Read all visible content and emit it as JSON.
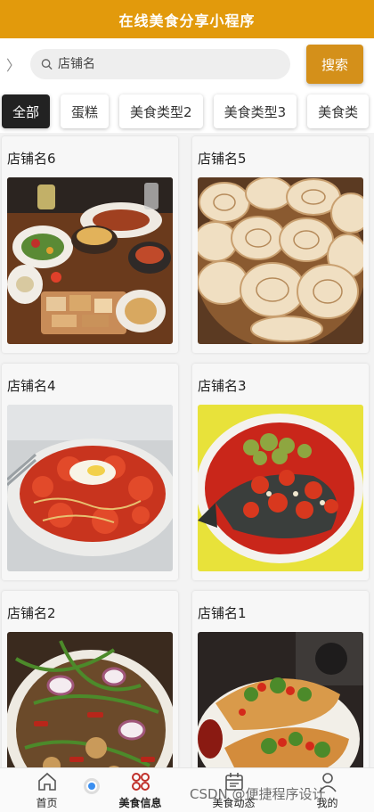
{
  "header": {
    "title": "在线美食分享小程序"
  },
  "search": {
    "placeholder": "店铺名",
    "button_label": "搜索"
  },
  "categories": [
    "全部",
    "蛋糕",
    "美食类型2",
    "美食类型3",
    "美食类"
  ],
  "shops": [
    {
      "name": "店铺名6",
      "image": "food-platter-photo"
    },
    {
      "name": "店铺名5",
      "image": "rose-pastry-photo"
    },
    {
      "name": "店铺名4",
      "image": "tomato-egg-pasta-photo"
    },
    {
      "name": "店铺名3",
      "image": "chili-fish-head-photo"
    },
    {
      "name": "店铺名2",
      "image": "stir-fry-salad-photo"
    },
    {
      "name": "店铺名1",
      "image": "stuffed-flatbread-photo"
    }
  ],
  "bottom_nav": [
    {
      "label": "首页",
      "icon": "home-icon"
    },
    {
      "label": "美食信息",
      "icon": "clover-icon"
    },
    {
      "label": "美食动态",
      "icon": "calendar-icon"
    },
    {
      "label": "我的",
      "icon": "user-icon"
    }
  ],
  "watermark": "CSDN @便捷程序设计",
  "colors": {
    "accent": "#e29a0c",
    "button": "#d4901a",
    "active_icon": "#c0302a"
  }
}
